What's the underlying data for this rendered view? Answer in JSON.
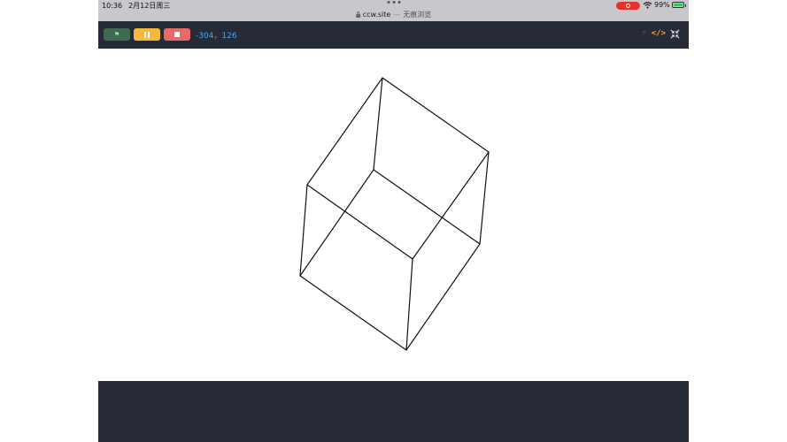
{
  "status_bar": {
    "time": "10:36",
    "date": "2月12日周三",
    "url": "ccw.site",
    "separator": "—",
    "browse_mode": "无痕浏览",
    "battery_percent": "99%",
    "record_color": "#e5322e",
    "battery_color": "#34c759"
  },
  "toolbar": {
    "flag_icon": "flag-icon",
    "pause_icon": "pause-icon",
    "stop_icon": "stop-icon",
    "coords": "-304，126",
    "right_icons": [
      "bolt-icon",
      "code-icon",
      "shrink-icon"
    ],
    "flag_color": "#3e6b4f",
    "pause_color": "#f5b83d",
    "stop_color": "#e86a66",
    "coords_color": "#3fa8f5"
  },
  "stage": {
    "content": "wireframe cube",
    "background": "#ffffff"
  }
}
